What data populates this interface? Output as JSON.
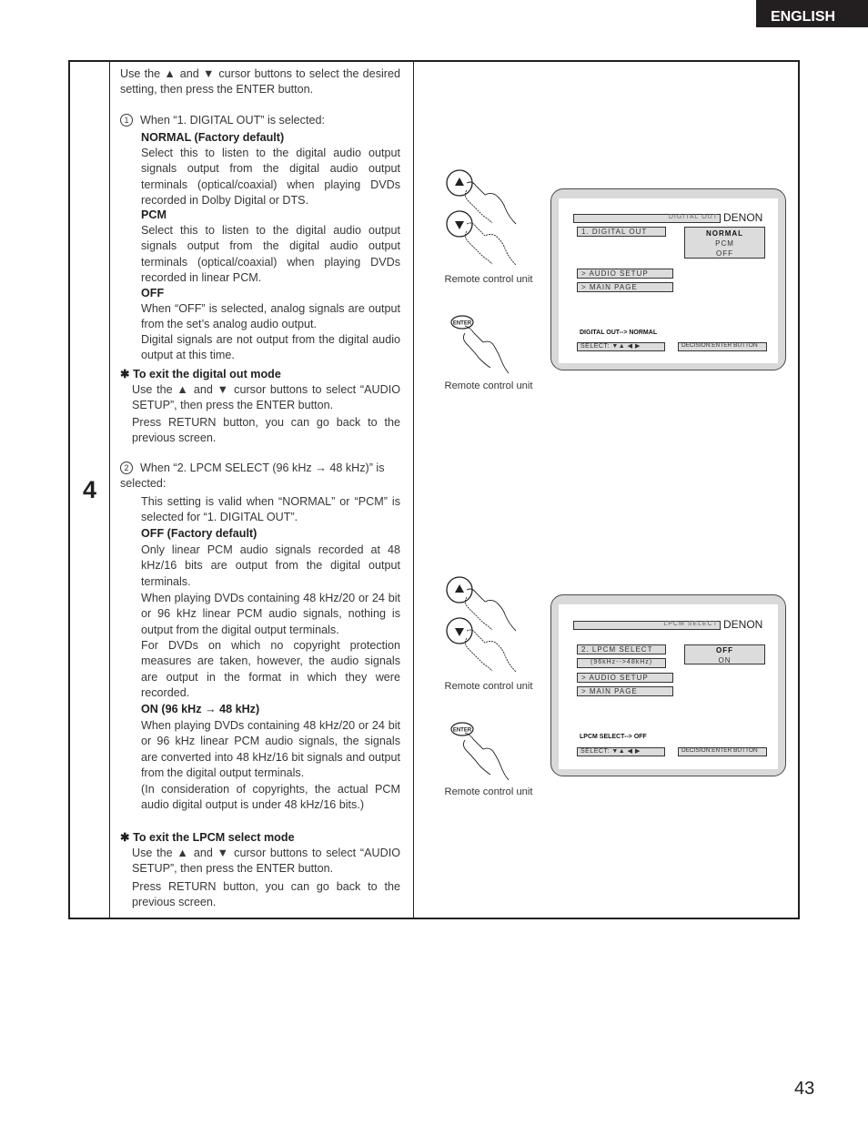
{
  "header": {
    "language_tab": "ENGLISH"
  },
  "page_number": "43",
  "step": {
    "number": "4"
  },
  "text": {
    "intro": "Use the ▲ and ▼ cursor buttons to select the desired setting, then press the ENTER button.",
    "section1": {
      "marker": "1",
      "heading": "When “1. DIGITAL OUT” is selected:",
      "options": [
        {
          "label": "NORMAL (Factory default)",
          "desc": "Select this to listen to the digital audio output signals output from the digital audio output terminals (optical/coaxial) when playing DVDs recorded in Dolby Digital or DTS."
        },
        {
          "label": "PCM",
          "desc": "Select this to listen to the digital audio output signals output from the digital audio output terminals (optical/coaxial) when playing DVDs recorded in linear PCM."
        },
        {
          "label": "OFF",
          "desc": "When “OFF” is selected, analog signals are output from the set’s analog audio output.",
          "desc2": "Digital signals are not output from the digital audio output at this time."
        }
      ],
      "exit_title": "To exit the digital out mode",
      "exit_text1": "Use the ▲ and ▼ cursor buttons to select “AUDIO SETUP”, then press the ENTER button.",
      "exit_text2": "Press RETURN button, you can go back to the previous screen."
    },
    "section2": {
      "marker": "2",
      "heading": "When “2. LPCM SELECT (96 kHz → 48 kHz)” is selected:",
      "note": "This setting is valid when “NORMAL” or “PCM” is selected for “1. DIGITAL OUT”.",
      "off_label": "OFF (Factory default)",
      "off_desc1": "Only linear PCM audio signals recorded at 48 kHz/16 bits are output from the digital output terminals.",
      "off_desc2": "When playing DVDs containing 48 kHz/20 or 24 bit or 96 kHz linear PCM audio signals, nothing is output from the digital output terminals.",
      "off_desc3": "For DVDs on which no copyright protection measures are taken, however, the audio signals are output in the format in which they were recorded.",
      "on_label": "ON (96 kHz → 48 kHz)",
      "on_desc1": "When playing DVDs containing 48 kHz/20 or 24 bit or 96 kHz linear PCM audio signals, the signals are converted into 48 kHz/16 bit signals and output from the digital output terminals.",
      "on_desc2": "(In consideration of copyrights, the actual PCM audio digital output is under 48 kHz/16 bits.)",
      "exit_title": "To exit the LPCM select mode",
      "exit_text1": "Use the ▲ and ▼ cursor buttons to select “AUDIO SETUP”, then press the ENTER button.",
      "exit_text2": "Press RETURN button, you can go back to the previous screen."
    },
    "star_symbol": "✱"
  },
  "figures": {
    "caption": "Remote control unit",
    "enter_label": "ENTER",
    "screen1": {
      "title": "DIGITAL OUT",
      "brand": "DENON",
      "menu_item": "1. DIGITAL OUT",
      "options": [
        "NORMAL",
        "PCM",
        "OFF"
      ],
      "selected_option": "NORMAL",
      "link1": "> AUDIO SETUP",
      "link2": "> MAIN PAGE",
      "status": "DIGITAL OUT--> NORMAL",
      "select_hint": "SELECT:  ▼▲ ◀ ▶",
      "decision_hint": "DECISION:ENTER BUTTON"
    },
    "screen2": {
      "title": "LPCM SELECT",
      "brand": "DENON",
      "menu_item": "2. LPCM SELECT",
      "menu_item_sub": "(96kHz-->48kHz)",
      "options": [
        "OFF",
        "ON"
      ],
      "selected_option": "OFF",
      "link1": "> AUDIO SETUP",
      "link2": "> MAIN PAGE",
      "status": "LPCM SELECT--> OFF",
      "select_hint": "SELECT:  ▼▲ ◀ ▶",
      "decision_hint": "DECISION:ENTER BUTTON"
    }
  }
}
